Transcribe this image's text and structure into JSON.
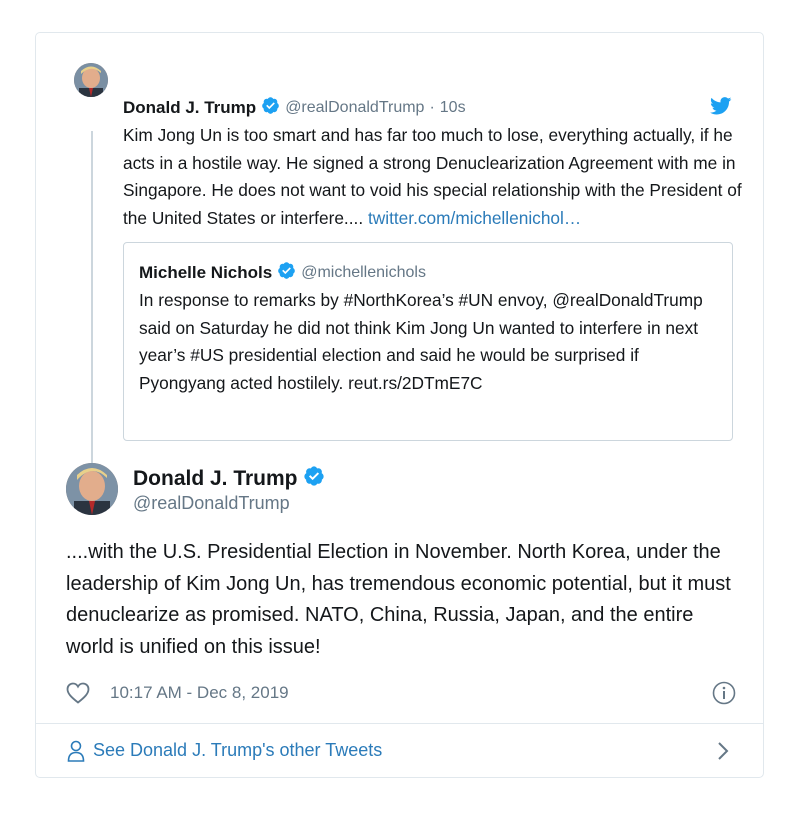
{
  "parent_tweet": {
    "name": "Donald J. Trump",
    "handle": "@realDonaldTrump",
    "separator": "·",
    "time": "10s",
    "text": "Kim Jong Un is too smart and has far too much to lose, everything actually, if he acts in a hostile way. He signed a strong Denuclearization Agreement with me in Singapore. He does not want to void his special relationship with the President of the United States or interfere....",
    "link": "twitter.com/michellenichol…"
  },
  "quoted_tweet": {
    "name": "Michelle Nichols",
    "handle": "@michellenichols",
    "text": "In response to remarks by #NorthKorea’s #UN envoy, @realDonaldTrump said on Saturday he did not think Kim Jong Un wanted to interfere in next year’s #US presidential election and said he would be surprised if Pyongyang acted hostilely. reut.rs/2DTmE7C"
  },
  "main_tweet": {
    "name": "Donald J. Trump",
    "handle": "@realDonaldTrump",
    "text": "....with the U.S. Presidential Election in November. North Korea, under the leadership of Kim Jong Un, has tremendous economic potential, but it must denuclearize as promised. NATO, China, Russia, Japan, and the entire world is unified on this issue!",
    "timestamp": "10:17 AM - Dec 8, 2019"
  },
  "footer": {
    "label": "See Donald J. Trump's other Tweets"
  },
  "icons": {
    "verified": "verified-badge-icon",
    "bird": "twitter-bird-icon",
    "heart": "heart-icon",
    "info": "info-icon",
    "person": "person-icon",
    "chevron": "chevron-right-icon"
  },
  "colors": {
    "brand_blue": "#1da1f2",
    "link_blue": "#2b7bb9",
    "secondary_text": "#657786",
    "border": "#e1e8ed"
  }
}
